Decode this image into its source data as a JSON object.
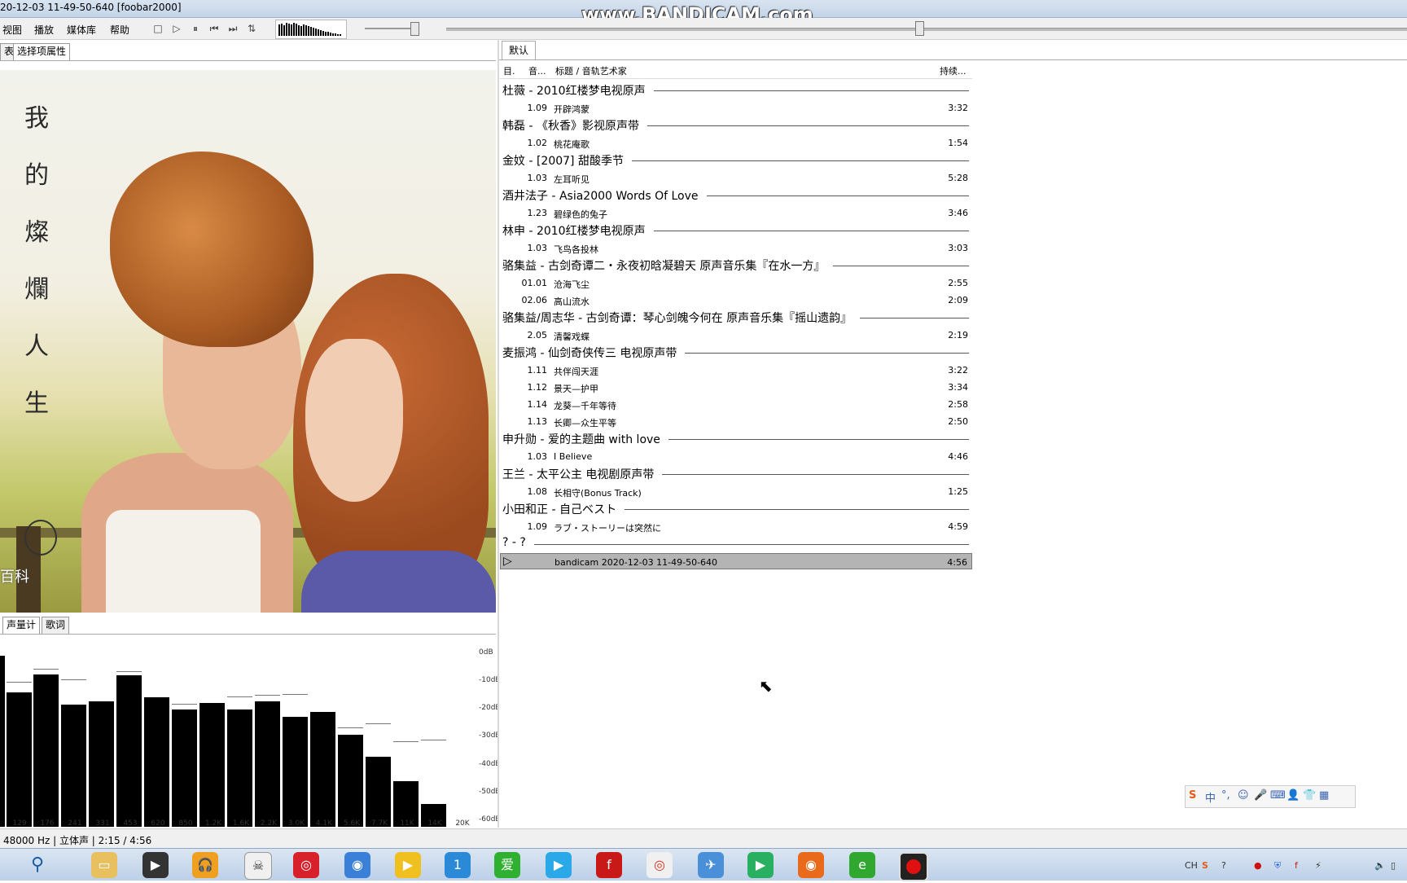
{
  "window": {
    "title": "20-12-03 11-49-50-640  [foobar2000]",
    "watermark": "www.BANDICAM.com"
  },
  "menu": {
    "items": [
      "视图",
      "播放",
      "媒体库",
      "帮助"
    ]
  },
  "toolbar": {
    "stop": "□",
    "play": "▷",
    "pause": "⏸",
    "prev": "⏮",
    "next": "⏭",
    "random": "⇅"
  },
  "left_tabs": {
    "partial": "表",
    "properties": "选择项属性"
  },
  "art": {
    "chars": [
      "我",
      "的",
      "燦",
      "爛",
      "人",
      "生"
    ],
    "corner_text": "百科"
  },
  "bottom_tabs": {
    "meter": "声量计",
    "lyrics": "歌词"
  },
  "spectrum": {
    "db_labels": [
      "0dB",
      "-10dB",
      "-20dB",
      "-30dB",
      "-40dB",
      "-50dB",
      "-60dB"
    ],
    "freq_labels": [
      "129",
      "176",
      "241",
      "331",
      "453",
      "620",
      "850",
      "1.2K",
      "1.6K",
      "2.2K",
      "3.0K",
      "4.1K",
      "5.6K",
      "7.7K",
      "11K",
      "14K",
      "20K"
    ]
  },
  "playlist": {
    "tab": "默认",
    "headers": {
      "idx": "目.",
      "track": "音...",
      "title": "标题 / 音轨艺术家",
      "duration": "持续..."
    },
    "groups": [
      {
        "header": "杜薇 - 2010红楼梦电视原声",
        "tracks": [
          {
            "no": "1.09",
            "title": "开辟鸿蒙",
            "dur": "3:32"
          }
        ]
      },
      {
        "header": "韩磊 - 《秋香》影视原声带",
        "tracks": [
          {
            "no": "1.02",
            "title": "桃花庵歌",
            "dur": "1:54"
          }
        ]
      },
      {
        "header": "金妏 - [2007] 甜酸季节",
        "tracks": [
          {
            "no": "1.03",
            "title": "左耳听见",
            "dur": "5:28"
          }
        ]
      },
      {
        "header": "酒井法子 - Asia2000 Words Of Love",
        "tracks": [
          {
            "no": "1.23",
            "title": "碧绿色的兔子",
            "dur": "3:46"
          }
        ]
      },
      {
        "header": "林申 - 2010红楼梦电视原声",
        "tracks": [
          {
            "no": "1.03",
            "title": "飞鸟各投林",
            "dur": "3:03"
          }
        ]
      },
      {
        "header": "骆集益 - 古剑奇谭二・永夜初晗凝碧天 原声音乐集『在水一方』",
        "tracks": [
          {
            "no": "01.01",
            "title": "沧海飞尘",
            "dur": "2:55"
          },
          {
            "no": "02.06",
            "title": "高山流水",
            "dur": "2:09"
          }
        ]
      },
      {
        "header": "骆集益/周志华 - 古剑奇谭：琴心剑魄今何在 原声音乐集『摇山遗韵』",
        "tracks": [
          {
            "no": "2.05",
            "title": "清馨戏蝶",
            "dur": "2:19"
          }
        ]
      },
      {
        "header": "麦振鸿 - 仙剑奇侠传三 电视原声带",
        "tracks": [
          {
            "no": "1.11",
            "title": "共伴闯天涯",
            "dur": "3:22"
          },
          {
            "no": "1.12",
            "title": "景天—护甲",
            "dur": "3:34"
          },
          {
            "no": "1.14",
            "title": "龙葵—千年等待",
            "dur": "2:58"
          },
          {
            "no": "1.13",
            "title": "长卿—众生平等",
            "dur": "2:50"
          }
        ]
      },
      {
        "header": "申升勋 - 爱的主题曲 with love",
        "tracks": [
          {
            "no": "1.03",
            "title": "I Believe",
            "dur": "4:46"
          }
        ]
      },
      {
        "header": "王兰 - 太平公主 电视剧原声带",
        "tracks": [
          {
            "no": "1.08",
            "title": "长相守(Bonus Track)",
            "dur": "1:25"
          }
        ]
      },
      {
        "header": "小田和正 - 自己ベスト",
        "tracks": [
          {
            "no": "1.09",
            "title": "ラブ・ストーリーは突然に",
            "dur": "4:59"
          }
        ]
      },
      {
        "header": "? - ?",
        "tracks": [
          {
            "no": "",
            "title": "bandicam 2020-12-03 11-49-50-640",
            "dur": "4:56"
          }
        ]
      }
    ]
  },
  "ime": {
    "zh": "中",
    "dot": "°,"
  },
  "status": {
    "text": "48000 Hz | 立体声 | 2:15 / 4:56"
  },
  "tray": {
    "lang": "CH"
  }
}
